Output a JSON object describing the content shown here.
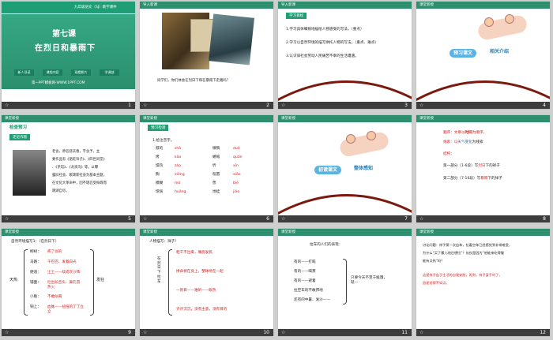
{
  "slides": [
    {
      "num": "1",
      "top_title": "九年级语文（SJ）教学课件",
      "lesson": "第七课",
      "title": "在烈日和暴雨下",
      "btns": [
        "新人导读",
        "课程内容",
        "观看影片",
        "学课部"
      ],
      "site": "第一PPT模板网-WWW.1PPT.COM"
    },
    {
      "num": "2",
      "header": "导入新课",
      "question": "同学们，你们体会在烈日下和在暴雨下走路吗？"
    },
    {
      "num": "3",
      "header": "导入新课",
      "goal_tag": "学习目标",
      "goals": [
        "1.学习具体细致地描绘人物感受的写法。（重点）",
        "2.学习以自然环境的描写烘托人物的写法。（重点、难点）",
        "3.认识旧社会劳动人民痛苦不幸的生活遭遇。"
      ]
    },
    {
      "num": "4",
      "header": "课堂新授",
      "bubble1": "预习课文",
      "bubble2": "相关介绍"
    },
    {
      "num": "5",
      "header": "课堂新授",
      "check": "检查预习",
      "author_tag": "走近作者",
      "bio": [
        "老舍，原名舒庆春，字舍予，主",
        "要作品有《骆驼祥子》、《四世同堂》",
        "、《茶馆》、《龙须沟》等。以曝",
        "露旧社会、歌颂新社会为基本主题，",
        "在文化大革命中，因不堪忍受侮辱而",
        "跳湖自尽。"
      ]
    },
    {
      "num": "6",
      "header": "课堂新授",
      "tag": "预习检测",
      "q": "1.给注音字。",
      "pairs": [
        [
          "鼓的",
          "shā",
          "懒惰",
          "duò"
        ],
        [
          "烤",
          "kǎo",
          "蜷缩",
          "quán"
        ],
        [
          "燥热",
          "zào",
          "忻",
          "xīn"
        ],
        [
          "胸",
          "xiōng",
          "喧嚣",
          "xiāo"
        ],
        [
          "模糊",
          "mó",
          "憋",
          "biē"
        ],
        [
          "惊恍",
          "huǎng",
          "地挂",
          "jiǎo"
        ]
      ]
    },
    {
      "num": "7",
      "header": "课堂新授",
      "bubble1": "初读课文",
      "bubble2": "整体感知"
    },
    {
      "num": "8",
      "header": "课堂新授",
      "l1a": "顺序：文章以",
      "l1b": "时间",
      "l1c": "为顺序。",
      "l2a": "线索：以",
      "l2b": "天气变化",
      "l2c": "为线索",
      "l3": "结构：",
      "l4a": "第一部分（1-6段）写",
      "l4b": "烈日",
      "l4c": "下的祥子",
      "l5a": "第二部分（7-16段）写",
      "l5b": "暴雨",
      "l5c": "下的祥子"
    },
    {
      "num": "9",
      "header": "课堂新授",
      "title": "自然环境描写1：（在烈日下）",
      "main": "天热",
      "right": "发狂",
      "items": [
        [
          "柳树：",
          "病了似的"
        ],
        [
          "马路：",
          "干巴巴、发着白光"
        ],
        [
          "便道：",
          "尘土——续成灰沙阵"
        ],
        [
          "铺面：",
          "吐出长舌头、鼻孔冒热火"
        ],
        [
          "小贩：",
          "不敢吆喝"
        ],
        [
          "铜上：",
          "血脉——扭扭的丁丁立立"
        ]
      ]
    },
    {
      "num": "10",
      "header": "课堂新授",
      "title": "人物描写：祥子！",
      "side": "在烈日下拉车",
      "items": [
        "咂干不出来，嘴唇发焦",
        "拼命要在身上，整球地在一起",
        "一则目——难听——眼热",
        "许许沉沉，没有主意，没有目的"
      ]
    },
    {
      "num": "11",
      "header": "课堂新授",
      "title": "拉车的人们的表现：",
      "items": [
        "有的——打盹",
        "有的——喝茶",
        "有的——避着",
        "拉空车的不敢邦地",
        "还有的中暑、发沙——"
      ],
      "note": "只要今天不至于挨饿，就—"
    },
    {
      "num": "12",
      "header": "课堂新授",
      "p1": [
        "讨论问题：祥子第一次出车，拉着空车已经感觉到非常难受，",
        "为什么“买了骡儿地还想拉”？仅仅是因为“他能来吃得慢",
        "能有点热”吗？"
      ],
      "p2": [
        "这是祥子出于生活的自我安慰，再到，祥子身手时了，",
        "因差觉得不如点。"
      ]
    }
  ],
  "colors": {
    "accent": "#2e8f6f",
    "red": "#d21b1b",
    "bar": "#3d3d3d"
  },
  "footer_star": "☆"
}
